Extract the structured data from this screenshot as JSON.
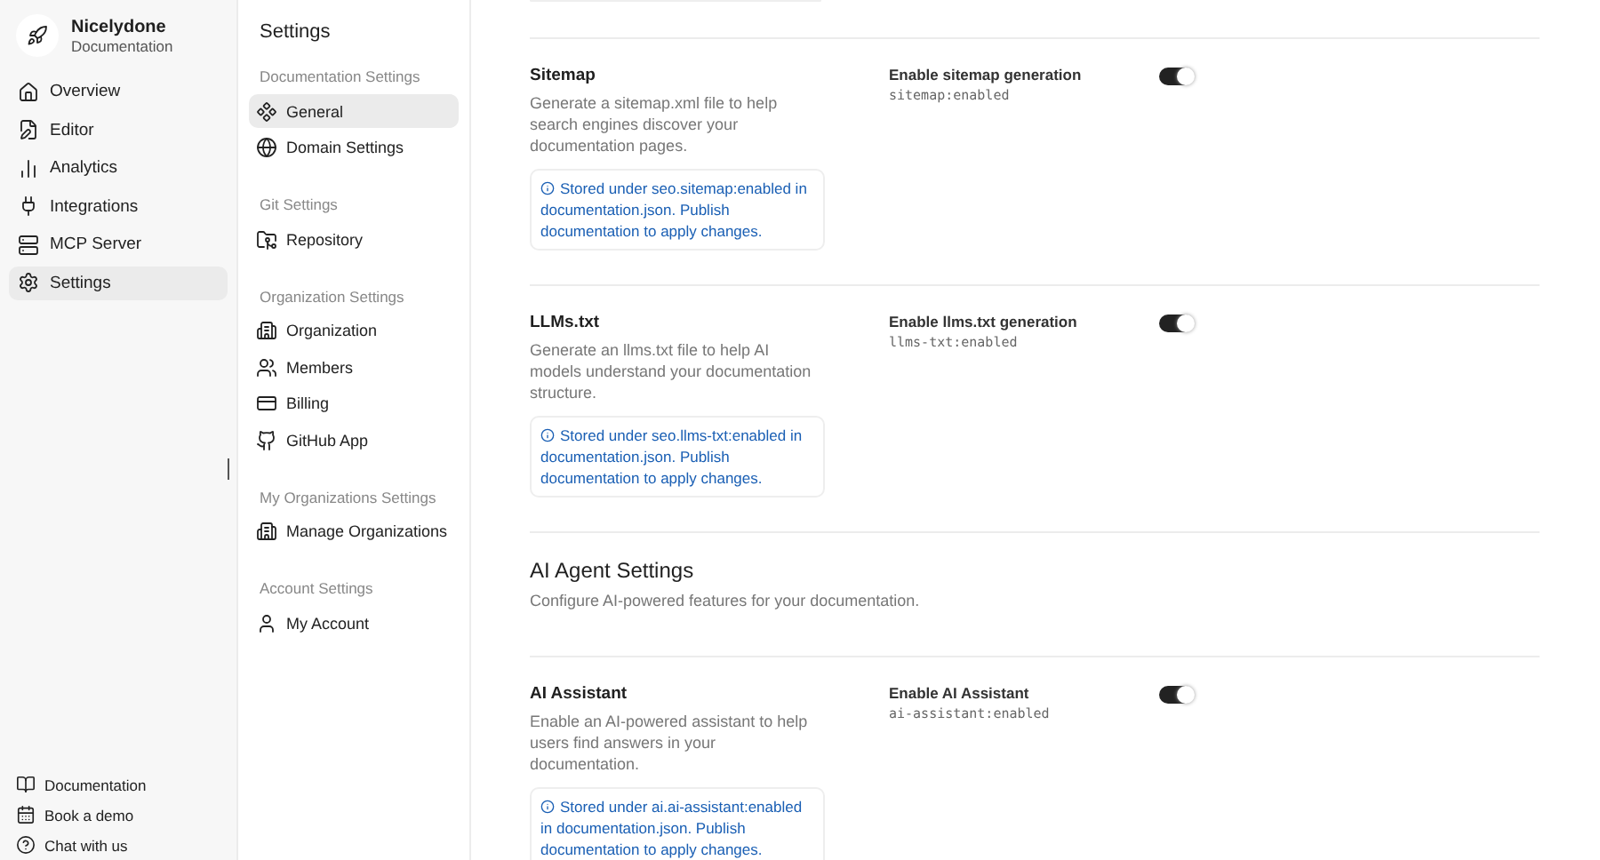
{
  "brand": {
    "name": "Nicelydone",
    "subtitle": "Documentation"
  },
  "nav": [
    {
      "label": "Overview",
      "selected": false
    },
    {
      "label": "Editor",
      "selected": false
    },
    {
      "label": "Analytics",
      "selected": false
    },
    {
      "label": "Integrations",
      "selected": false
    },
    {
      "label": "MCP Server",
      "selected": false
    },
    {
      "label": "Settings",
      "selected": true
    }
  ],
  "footer_links": [
    {
      "label": "Documentation"
    },
    {
      "label": "Book a demo"
    },
    {
      "label": "Chat with us"
    }
  ],
  "settings_nav": {
    "title": "Settings",
    "groups": [
      {
        "title": "Documentation Settings",
        "items": [
          {
            "label": "General",
            "selected": true
          },
          {
            "label": "Domain Settings",
            "selected": false
          }
        ]
      },
      {
        "title": "Git Settings",
        "items": [
          {
            "label": "Repository",
            "selected": false
          }
        ]
      },
      {
        "title": "Organization Settings",
        "items": [
          {
            "label": "Organization",
            "selected": false
          },
          {
            "label": "Members",
            "selected": false
          },
          {
            "label": "Billing",
            "selected": false
          },
          {
            "label": "GitHub App",
            "selected": false
          }
        ]
      },
      {
        "title": "My Organizations Settings",
        "items": [
          {
            "label": "Manage Organizations",
            "selected": false
          }
        ]
      },
      {
        "title": "Account Settings",
        "items": [
          {
            "label": "My Account",
            "selected": false
          }
        ]
      }
    ]
  },
  "content": [
    {
      "kind": "setting",
      "title": "Sitemap",
      "description": "Generate a sitemap.xml file to help search engines discover your documentation pages.",
      "note": "Stored under seo.sitemap:enabled in documentation.json. Publish documentation to apply changes.",
      "toggle_label": "Enable sitemap generation",
      "key": "sitemap:enabled",
      "on": true
    },
    {
      "kind": "setting",
      "title": "LLMs.txt",
      "description": "Generate an llms.txt file to help AI models understand your documentation structure.",
      "note": "Stored under seo.llms-txt:enabled in documentation.json. Publish documentation to apply changes.",
      "toggle_label": "Enable llms.txt generation",
      "key": "llms-txt:enabled",
      "on": true
    },
    {
      "kind": "heading",
      "title": "AI Agent Settings",
      "description": "Configure AI-powered features for your documentation."
    },
    {
      "kind": "setting",
      "title": "AI Assistant",
      "description": "Enable an AI-powered assistant to help users find answers in your documentation.",
      "note": "Stored under ai.ai-assistant:enabled in documentation.json. Publish documentation to apply changes.",
      "toggle_label": "Enable AI Assistant",
      "key": "ai-assistant:enabled",
      "on": true
    }
  ]
}
